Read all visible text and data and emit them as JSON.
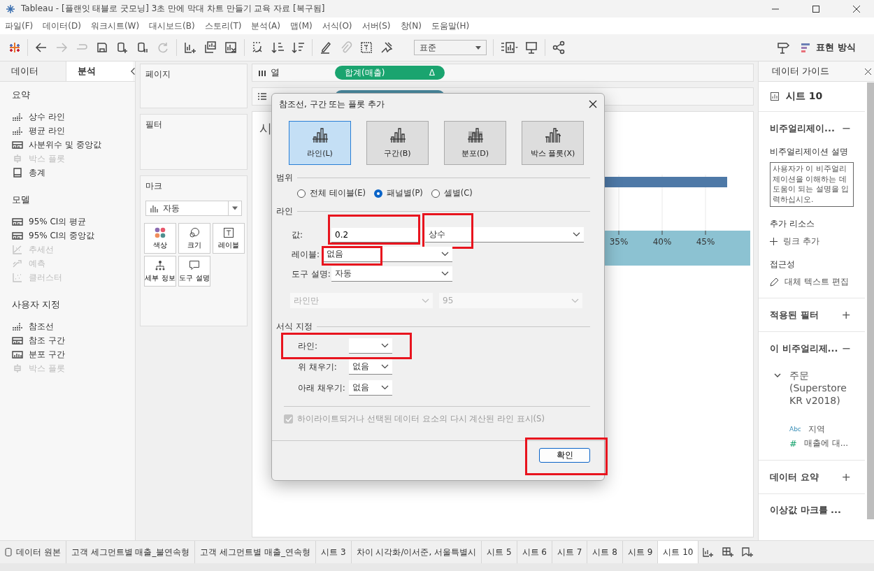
{
  "window": {
    "title": "Tableau - [플랜잇 태블로 굿모닝] 3초 만에 막대 차트 만들기 교육 자료 [복구됨]"
  },
  "menu": [
    "파일(F)",
    "데이터(D)",
    "워크시트(W)",
    "대시보드(B)",
    "스토리(T)",
    "분석(A)",
    "맵(M)",
    "서식(O)",
    "서버(S)",
    "창(N)",
    "도움말(H)"
  ],
  "toolbar": {
    "fit_dropdown": "표준",
    "show_me": "표현 방식"
  },
  "left_panel": {
    "tabs": [
      {
        "label": "데이터",
        "selected": false
      },
      {
        "label": "분석",
        "selected": true
      }
    ],
    "sections": [
      {
        "title": "요약",
        "items": [
          {
            "label": "상수 라인",
            "kind": "line",
            "disabled": false
          },
          {
            "label": "평균 라인",
            "kind": "line",
            "disabled": false
          },
          {
            "label": "사분위수 및 중앙값",
            "kind": "band",
            "disabled": false
          },
          {
            "label": "박스 플롯",
            "kind": "box",
            "disabled": true
          },
          {
            "label": "총계",
            "kind": "total",
            "disabled": false
          }
        ]
      },
      {
        "title": "모델",
        "items": [
          {
            "label": "95% CI의 평균",
            "kind": "band",
            "disabled": false
          },
          {
            "label": "95% CI의 중앙값",
            "kind": "band",
            "disabled": false
          },
          {
            "label": "추세선",
            "kind": "trend",
            "disabled": true
          },
          {
            "label": "예측",
            "kind": "forecast",
            "disabled": true
          },
          {
            "label": "클러스터",
            "kind": "cluster",
            "disabled": true
          }
        ]
      },
      {
        "title": "사용자 지정",
        "items": [
          {
            "label": "참조선",
            "kind": "line",
            "disabled": false
          },
          {
            "label": "참조 구간",
            "kind": "band",
            "disabled": false
          },
          {
            "label": "분포 구간",
            "kind": "dist",
            "disabled": false
          },
          {
            "label": "박스 플롯",
            "kind": "box",
            "disabled": true
          }
        ]
      }
    ]
  },
  "pages": {
    "title": "페이지"
  },
  "filters": {
    "title": "필터"
  },
  "marks": {
    "title": "마크",
    "type": "자동",
    "cards": [
      {
        "label": "색상",
        "kind": "color"
      },
      {
        "label": "크기",
        "kind": "size"
      },
      {
        "label": "레이블",
        "kind": "label"
      },
      {
        "label": "세부 정보",
        "kind": "detail"
      },
      {
        "label": "도구 설명",
        "kind": "tooltip"
      }
    ]
  },
  "columns_shelf": {
    "label": "열",
    "pill": "합계(매출)",
    "pill_mark": "Δ"
  },
  "view": {
    "title": "시",
    "axis_ticks": [
      "35%",
      "40%",
      "45%"
    ]
  },
  "dialog": {
    "title": "참조선, 구간 또는 플롯 추가",
    "types": [
      {
        "label": "라인(L)",
        "selected": true
      },
      {
        "label": "구간(B)",
        "selected": false
      },
      {
        "label": "분포(D)",
        "selected": false
      },
      {
        "label": "박스 플롯(X)",
        "selected": false
      }
    ],
    "scope": {
      "title": "범위",
      "options": [
        {
          "label": "전체 테이블(E)",
          "selected": false
        },
        {
          "label": "패널별(P)",
          "selected": true
        },
        {
          "label": "셀별(C)",
          "selected": false
        }
      ]
    },
    "line": {
      "title": "라인",
      "value_label": "값:",
      "value": "0.2",
      "value_highlighted": true,
      "aggregation": "상수",
      "aggregation_highlighted": true,
      "label_label": "레이블:",
      "label_value": "없음",
      "label_highlighted": true,
      "tooltip_label": "도구 설명:",
      "tooltip_value": "자동",
      "interval": "라인만",
      "confidence": "95"
    },
    "format": {
      "title": "서식 지정",
      "rows": [
        {
          "label": "라인:",
          "value": "",
          "highlighted": true
        },
        {
          "label": "위 채우기:",
          "value": "없음",
          "highlighted": false
        },
        {
          "label": "아래 채우기:",
          "value": "없음",
          "highlighted": false
        }
      ]
    },
    "recalc": {
      "label": "하이라이트되거나 선택된 데이터 요소의 다시 계산된 라인 표시(S)",
      "checked": true,
      "disabled": true
    },
    "ok": {
      "label": "확인",
      "highlighted": true
    }
  },
  "data_guide": {
    "title": "데이터 가이드",
    "sheet": "시트 10",
    "viz_section": {
      "title": "비주얼리제이...",
      "toggle": "−"
    },
    "description_label": "비주얼리제이션 설명",
    "description_placeholder": "사용자가 이 비주얼리제이션을 이해하는 데 도움이 되는 설명을 입력하십시오.",
    "resources_label": "추가 리소스",
    "add_link": "링크 추가",
    "accessibility_label": "접근성",
    "alt_text": "대체 텍스트 편집",
    "filters_section": {
      "title": "적용된 필터",
      "toggle": "+"
    },
    "fields_section": {
      "title": "이 비주얼리제...",
      "toggle": "−"
    },
    "datasource": {
      "name": "주문 (Superstore KR v2018)",
      "expanded": true,
      "children": [
        {
          "label": "지역",
          "type": "Abc",
          "kind": "dimension"
        },
        {
          "label": "매출에 대...",
          "type": "#",
          "kind": "measure"
        }
      ]
    },
    "summary_section": {
      "title": "데이터 요약",
      "toggle": "+"
    },
    "outlier_section": {
      "title": "이상값 마크를 ..."
    }
  },
  "sheet_tabs": [
    {
      "label": "데이터 원본",
      "kind": "source",
      "selected": false
    },
    {
      "label": "고객 세그먼트별 매출_불연속형",
      "kind": "sheet",
      "selected": false
    },
    {
      "label": "고객 세그먼트별 매출_연속형",
      "kind": "sheet",
      "selected": false
    },
    {
      "label": "시트 3",
      "kind": "sheet",
      "selected": false
    },
    {
      "label": "차이 시각화/이서준, 서울특별시",
      "kind": "sheet",
      "selected": false
    },
    {
      "label": "시트 5",
      "kind": "sheet",
      "selected": false
    },
    {
      "label": "시트 6",
      "kind": "sheet",
      "selected": false
    },
    {
      "label": "시트 7",
      "kind": "sheet",
      "selected": false
    },
    {
      "label": "시트 8",
      "kind": "sheet",
      "selected": false
    },
    {
      "label": "시트 9",
      "kind": "sheet",
      "selected": false
    },
    {
      "label": "시트 10",
      "kind": "sheet",
      "selected": true
    }
  ]
}
